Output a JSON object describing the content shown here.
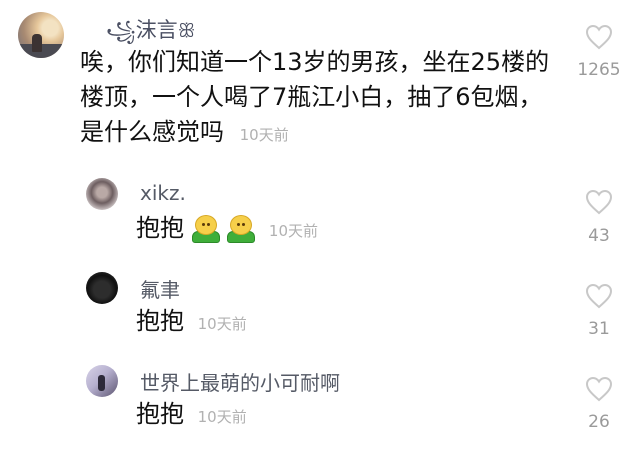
{
  "main_comment": {
    "username": "沫言",
    "username_prefix": "꧁",
    "username_suffix": "ꕥ",
    "text_lines": [
      "唉，你们知道一个13岁的男孩，坐在25楼的",
      "楼顶，一个人喝了7瓶江小白，抽了6包烟，",
      "是什么感觉吗"
    ],
    "time": "10天前",
    "likes": "1265"
  },
  "replies": [
    {
      "username": "xikz.",
      "text": "抱抱",
      "emoji": [
        "hug-emoji",
        "hug-emoji"
      ],
      "time": "10天前",
      "likes": "43"
    },
    {
      "username": "氟聿",
      "text": "抱抱",
      "emoji": [],
      "time": "10天前",
      "likes": "31"
    },
    {
      "username": "世界上最萌的小可耐啊",
      "text": "抱抱",
      "emoji": [],
      "time": "10天前",
      "likes": "26"
    }
  ],
  "icons": {
    "like": "heart-outline-icon"
  },
  "colors": {
    "username": "#555a66",
    "time": "#b1b1b1",
    "count": "#9a9a9a",
    "text": "#111111"
  }
}
